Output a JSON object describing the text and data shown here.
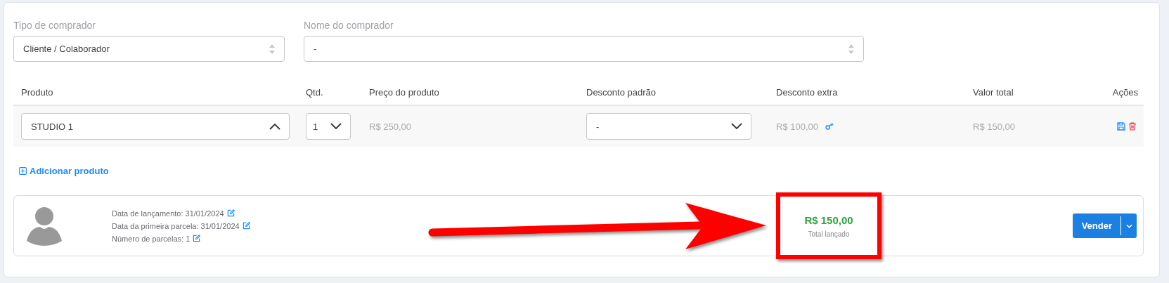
{
  "filters": [
    {
      "label": "Tipo de comprador",
      "value": "Cliente / Colaborador"
    },
    {
      "label": "Nome do comprador",
      "value": "-"
    }
  ],
  "table": {
    "columns": [
      "Produto",
      "Qtd.",
      "Preço do produto",
      "Desconto padrão",
      "Desconto extra",
      "Valor total",
      "Ações"
    ],
    "rows": [
      {
        "product": "STUDIO 1",
        "product_expanded": true,
        "quantity": "1",
        "price": "R$ 250,00",
        "default_discount": "-",
        "extra_discount": "R$ 100,00",
        "total": "R$ 150,00"
      }
    ]
  },
  "add_product": "Adicionar produto",
  "summary": {
    "details": [
      "Data de lançamento: 31/01/2024",
      "Data da primeira parcela: 31/01/2024",
      "Número de parcelas: 1"
    ],
    "total": "R$ 150,00",
    "total_label": "Total lançado",
    "action": "Vender"
  }
}
